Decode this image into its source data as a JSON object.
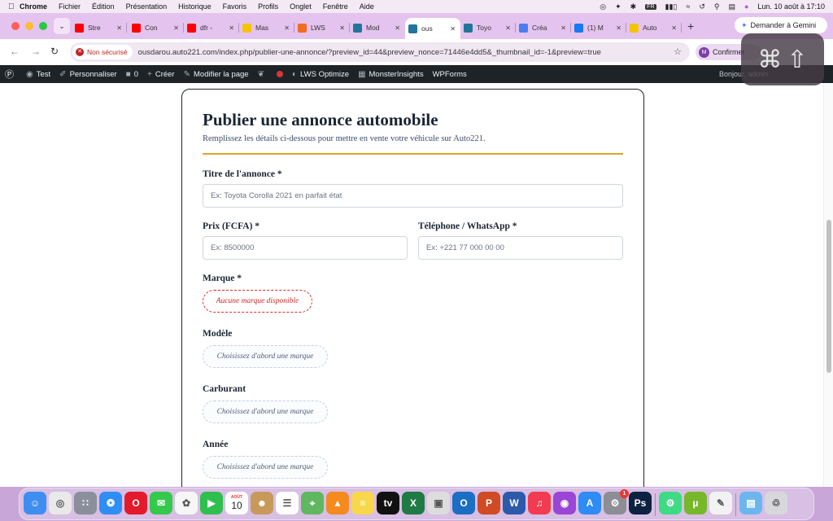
{
  "menubar": {
    "app": "Chrome",
    "items": [
      "Fichier",
      "Édition",
      "Présentation",
      "Historique",
      "Favoris",
      "Profils",
      "Onglet",
      "Fenêtre",
      "Aide"
    ],
    "keyboard_layout": "FR",
    "datetime": "Lun. 10 août à 17:10"
  },
  "tabs": [
    {
      "label": "Stre",
      "color": "#ff0000",
      "icon": "youtube-icon"
    },
    {
      "label": "Con",
      "color": "#ff0000",
      "icon": "youtube-icon"
    },
    {
      "label": "dfr -",
      "color": "#ff0000",
      "icon": "youtube-icon"
    },
    {
      "label": "Mas",
      "color": "#f5c400",
      "icon": "site-icon"
    },
    {
      "label": "LWS",
      "color": "#f26b21",
      "icon": "lws-icon"
    },
    {
      "label": "Mod",
      "color": "#21759b",
      "icon": "wordpress-icon"
    },
    {
      "label": "ous",
      "color": "#21759b",
      "icon": "wordpress-icon"
    },
    {
      "label": "Toyo",
      "color": "#21759b",
      "icon": "wordpress-icon"
    },
    {
      "label": "Créa",
      "color": "#4a7dee",
      "icon": "gemini-icon"
    },
    {
      "label": "(1) M",
      "color": "#1877f2",
      "icon": "facebook-icon"
    },
    {
      "label": "Auto",
      "color": "#f5c400",
      "icon": "site-icon"
    }
  ],
  "active_tab_index": 6,
  "gemini_button": "Demander à Gemini",
  "address_bar": {
    "security_label": "Non sécurisé",
    "url": "ousdarou.auto221.com/index.php/publier-une-annonce/?preview_id=44&preview_nonce=71446e4dd5&_thumbnail_id=-1&preview=true"
  },
  "profile_chip": {
    "initial": "M",
    "label": "Confirmer"
  },
  "admin_bar": {
    "site": "Test",
    "customize": "Personnaliser",
    "comments": "0",
    "new": "Créer",
    "edit": "Modifier la page",
    "lws": "LWS Optimize",
    "monster": "MonsterInsights",
    "wpforms": "WPForms",
    "howdy": "Bonjour, admin"
  },
  "form": {
    "title": "Publier une annonce automobile",
    "subtitle": "Remplissez les détails ci-dessous pour mettre en vente votre véhicule sur Auto221.",
    "accent_color": "#e3a32b",
    "fields": {
      "titre": {
        "label": "Titre de l'annonce *",
        "placeholder": "Ex: Toyota Corolla 2021 en parfait état"
      },
      "prix": {
        "label": "Prix (FCFA) *",
        "placeholder": "Ex: 8500000"
      },
      "telephone": {
        "label": "Téléphone / WhatsApp *",
        "placeholder": "Ex: +221 77 000 00 00"
      },
      "marque": {
        "label": "Marque *",
        "value": "Aucune marque disponible",
        "state": "error"
      },
      "modele": {
        "label": "Modèle",
        "value": "Choisissez d'abord une marque"
      },
      "carburant": {
        "label": "Carburant",
        "value": "Choisissez d'abord une marque"
      },
      "annee": {
        "label": "Année",
        "value": "Choisissez d'abord une marque"
      }
    }
  },
  "dock": {
    "calendar_month": "AOÛT",
    "calendar_day": "10",
    "apps": [
      "finder-icon",
      "chrome-icon",
      "launchpad-icon",
      "safari-icon",
      "opera-icon",
      "messages-icon",
      "photos-icon",
      "facetime-icon",
      "calendar-icon",
      "contacts-icon",
      "reminders-icon",
      "maps-icon",
      "vlc-icon",
      "notes-icon",
      "appletv-icon",
      "excel-icon",
      "screenshot-icon",
      "outlook-icon",
      "powerpoint-icon",
      "word-icon",
      "music-icon",
      "podcasts-icon",
      "appstore-icon",
      "system-settings-icon",
      "photoshop-icon",
      "android-icon",
      "utorrent-icon",
      "textedit-icon",
      "folder-icon",
      "trash-icon"
    ],
    "settings_badge": "1"
  }
}
